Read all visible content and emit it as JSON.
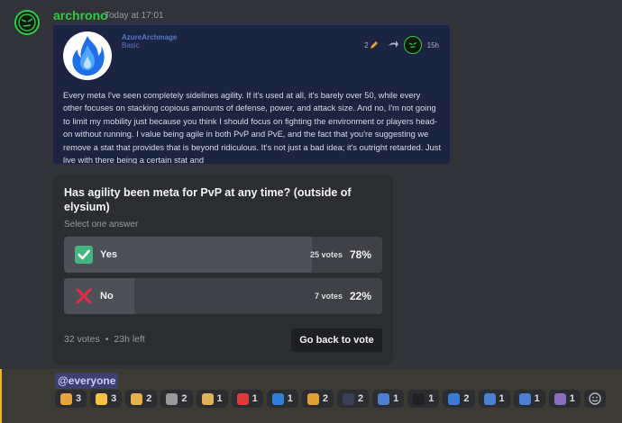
{
  "message": {
    "author": "archrono",
    "timestamp": "Today at 17:01",
    "author_color": "#2ecc40"
  },
  "post": {
    "username": "AzureArchmage",
    "role": "Basic",
    "edit_count": "2",
    "age": "15h",
    "body": "Every meta I've seen completely sidelines agility. If it's used at all, it's barely over 50, while every other focuses on stacking copious amounts of defense, power, and attack size. And no, I'm not going to limit my mobility just because you think I should focus on fighting the environment or players head-on without running. I value being agile in both PvP and PvE, and the fact that you're suggesting we remove a stat that provides that is beyond ridiculous. It's not just a bad idea; it's outright retarded. Just live with there being a certain stat and"
  },
  "poll": {
    "question": "Has agility been meta for PvP at any time? (outside of elysium)",
    "instruction": "Select one answer",
    "answers": [
      {
        "label": "Yes",
        "votes": "25 votes",
        "percent": "78%",
        "fraction": 0.78,
        "emoji": "check-mark-icon"
      },
      {
        "label": "No",
        "votes": "7 votes",
        "percent": "22%",
        "fraction": 0.22,
        "emoji": "cross-mark-icon"
      }
    ],
    "total_votes": "32 votes",
    "separator": "•",
    "time_left": "23h left",
    "button_label": "Go back to vote"
  },
  "mention": "@everyone",
  "reactions": [
    {
      "emoji": "person-standing-icon",
      "count": "3",
      "color": "#e8a33d"
    },
    {
      "emoji": "baby-face-icon",
      "count": "3",
      "color": "#f6c343"
    },
    {
      "emoji": "person-raising-hand-icon",
      "count": "2",
      "color": "#e8b04b"
    },
    {
      "emoji": "stone-face-icon",
      "count": "2",
      "color": "#9a9a9a"
    },
    {
      "emoji": "bread-icon",
      "count": "1",
      "color": "#e0b25c"
    },
    {
      "emoji": "calendar-icon",
      "count": "1",
      "color": "#dd3b3b"
    },
    {
      "emoji": "letter-l-icon",
      "count": "1",
      "color": "#2f7ed8"
    },
    {
      "emoji": "cat-icon",
      "count": "2",
      "color": "#e0a033"
    },
    {
      "emoji": "moon-icon",
      "count": "2",
      "color": "#3a3f5a"
    },
    {
      "emoji": "people-icon",
      "count": "1",
      "color": "#4a7fd4"
    },
    {
      "emoji": "pixel-face-icon",
      "count": "1",
      "color": "#222222"
    },
    {
      "emoji": "fish-icon",
      "count": "2",
      "color": "#3b7bd6"
    },
    {
      "emoji": "people-icon",
      "count": "1",
      "color": "#4a7fd4"
    },
    {
      "emoji": "people-icon",
      "count": "1",
      "color": "#4a7fd4"
    },
    {
      "emoji": "person-walking-cane-icon",
      "count": "1",
      "color": "#8a6fbf"
    }
  ]
}
